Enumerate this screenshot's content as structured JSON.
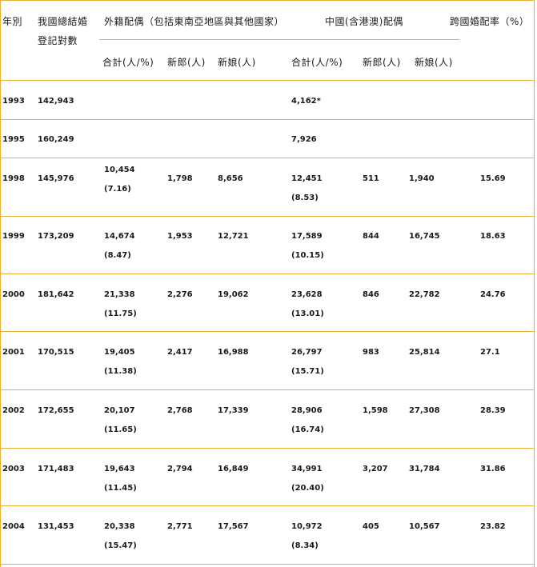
{
  "headers": {
    "year": "年別",
    "total_line1": "我國總結婚",
    "total_line2": "登記對數",
    "foreign_group": "外籍配偶（包括東南亞地區與其他國家）",
    "china_group": "中國(含港澳)配偶",
    "rate": "跨國婚配率（%）",
    "foreign_total": "合計(人/%)",
    "foreign_groom": "新郎(人)",
    "foreign_bride": "新娘(人)",
    "china_total": "合計(人/%)",
    "china_groom": "新郎(人)",
    "china_bride": "新娘(人)"
  },
  "rows": [
    {
      "year": "1993",
      "total": "142,943",
      "f_total": "",
      "f_pct": "",
      "f_groom": "",
      "f_bride": "",
      "c_total": "4,162*",
      "c_pct": "",
      "c_groom": "",
      "c_bride": "",
      "rate": ""
    },
    {
      "year": "1995",
      "total": "160,249",
      "f_total": "",
      "f_pct": "",
      "f_groom": "",
      "f_bride": "",
      "c_total": "7,926",
      "c_pct": "",
      "c_groom": "",
      "c_bride": "",
      "rate": ""
    },
    {
      "year": "1998",
      "total": "145,976",
      "f_total": "10,454",
      "f_pct": "(7.16)",
      "f_groom": "1,798",
      "f_bride": "8,656",
      "c_total": "12,451",
      "c_pct": "(8.53)",
      "c_groom": "511",
      "c_bride": "1,940",
      "rate": "15.69"
    },
    {
      "year": "1999",
      "total": "173,209",
      "f_total": "14,674",
      "f_pct": "(8.47)",
      "f_groom": "1,953",
      "f_bride": "12,721",
      "c_total": "17,589",
      "c_pct": "(10.15)",
      "c_groom": "844",
      "c_bride": "16,745",
      "rate": "18.63"
    },
    {
      "year": "2000",
      "total": "181,642",
      "f_total": "21,338",
      "f_pct": "(11.75)",
      "f_groom": "2,276",
      "f_bride": "19,062",
      "c_total": "23,628",
      "c_pct": "(13.01)",
      "c_groom": "846",
      "c_bride": "22,782",
      "rate": "24.76"
    },
    {
      "year": "2001",
      "total": "170,515",
      "f_total": "19,405",
      "f_pct": "(11.38)",
      "f_groom": "2,417",
      "f_bride": "16,988",
      "c_total": "26,797",
      "c_pct": "(15.71)",
      "c_groom": "983",
      "c_bride": "25,814",
      "rate": "27.1"
    },
    {
      "year": "2002",
      "total": "172,655",
      "f_total": "20,107",
      "f_pct": "(11.65)",
      "f_groom": "2,768",
      "f_bride": "17,339",
      "c_total": "28,906",
      "c_pct": "(16.74)",
      "c_groom": "1,598",
      "c_bride": "27,308",
      "rate": "28.39"
    },
    {
      "year": "2003",
      "total": "171,483",
      "f_total": "19,643",
      "f_pct": "(11.45)",
      "f_groom": "2,794",
      "f_bride": "16,849",
      "c_total": "34,991",
      "c_pct": "(20.40)",
      "c_groom": "3,207",
      "c_bride": "31,784",
      "rate": "31.86"
    },
    {
      "year": "2004",
      "total": "131,453",
      "f_total": "20,338",
      "f_pct": "(15.47)",
      "f_groom": "2,771",
      "f_bride": "17,567",
      "c_total": "10,972",
      "c_pct": "(8.34)",
      "c_groom": "405",
      "c_bride": "10,567",
      "rate": "23.82"
    }
  ]
}
